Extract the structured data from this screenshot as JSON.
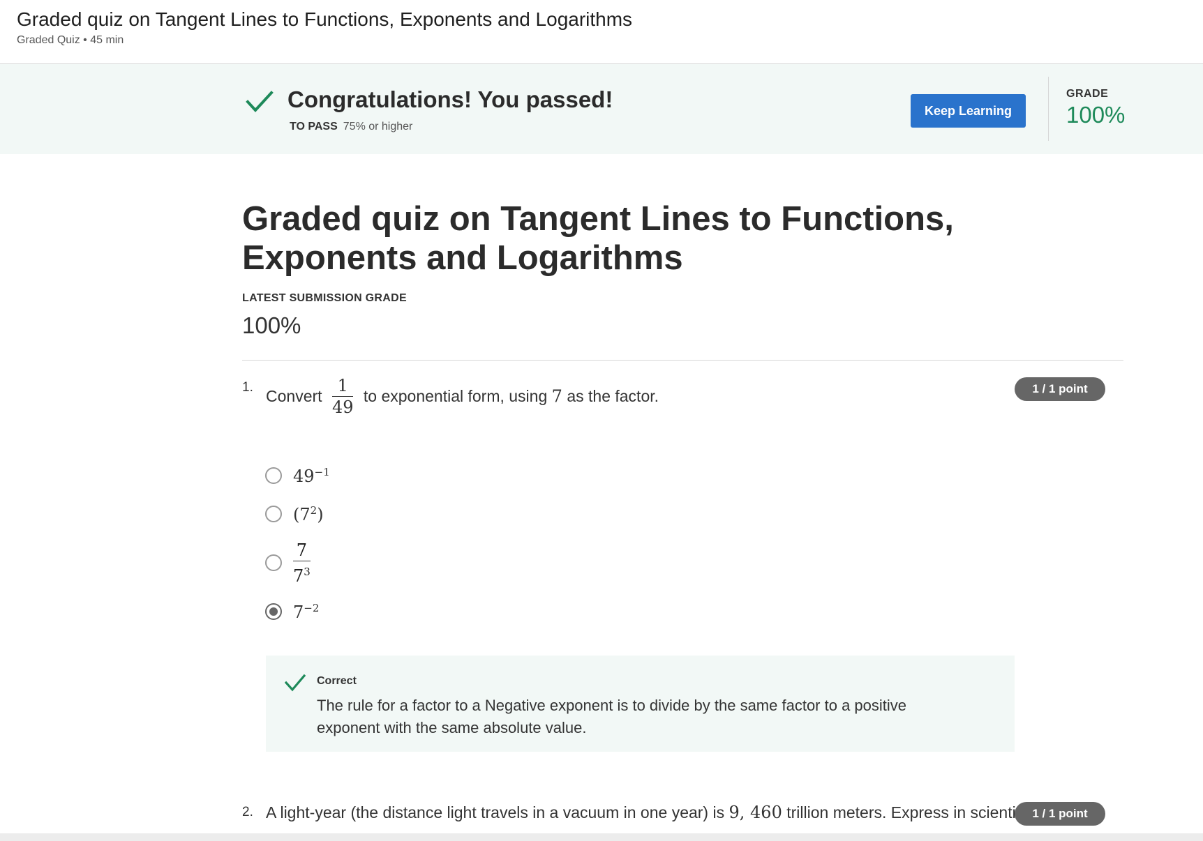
{
  "header": {
    "title": "Graded quiz on Tangent Lines to Functions, Exponents and Logarithms",
    "subtitle": "Graded Quiz • 45 min"
  },
  "banner": {
    "message": "Congratulations! You passed!",
    "to_pass_label": "TO PASS",
    "to_pass_value": "75% or higher",
    "keep_learning_label": "Keep Learning",
    "grade_label": "GRADE",
    "grade_value": "100%"
  },
  "main": {
    "title": "Graded quiz on Tangent Lines to Functions, Exponents and Logarithms",
    "latest_label": "LATEST SUBMISSION GRADE",
    "latest_value": "100%"
  },
  "questions": [
    {
      "number": "1.",
      "text_before": "Convert",
      "fraction_num": "1",
      "fraction_den": "49",
      "text_after": "to exponential form, using",
      "factor": "7",
      "text_end": "as the factor.",
      "points": "1 / 1 point",
      "options": [
        {
          "base": "49",
          "exp": "−1",
          "selected": false
        },
        {
          "base": "(7",
          "exp": "2",
          "suffix": ")",
          "selected": false
        },
        {
          "frac_num": "7",
          "frac_den_base": "7",
          "frac_den_exp": "3",
          "selected": false
        },
        {
          "base": "7",
          "exp": "−2",
          "selected": true
        }
      ],
      "feedback": {
        "label": "Correct",
        "text": "The rule for  a factor to a Negative exponent is to divide by the same factor to a positive exponent with the same absolute value."
      }
    },
    {
      "number": "2.",
      "text_before": "A light-year (the distance light travels in a vacuum in one year) is",
      "value": "9, 460",
      "text_after": "trillion meters. Express in scientific",
      "points": "1 / 1 point"
    }
  ],
  "colors": {
    "accent_blue": "#2a73cc",
    "success_green": "#1e8a5a",
    "banner_bg": "#f2f8f6",
    "points_badge": "#666666"
  }
}
